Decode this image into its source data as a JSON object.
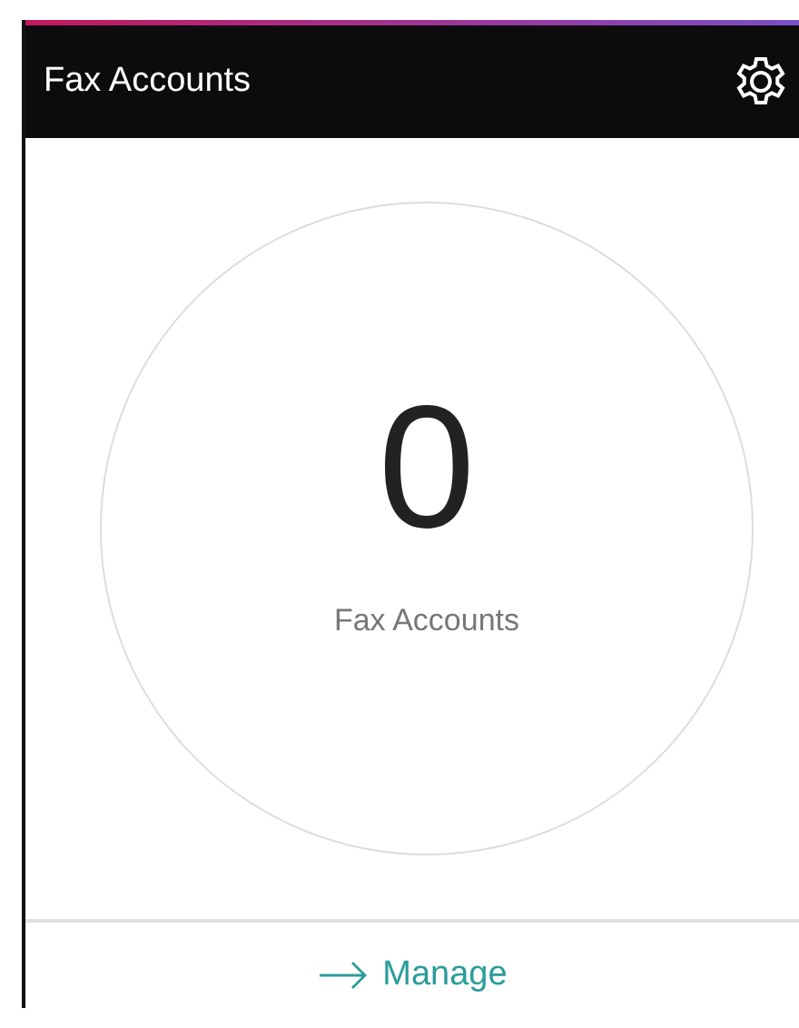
{
  "header": {
    "title": "Fax Accounts"
  },
  "summary": {
    "count": "0",
    "label": "Fax Accounts"
  },
  "footer": {
    "link": "Manage"
  }
}
